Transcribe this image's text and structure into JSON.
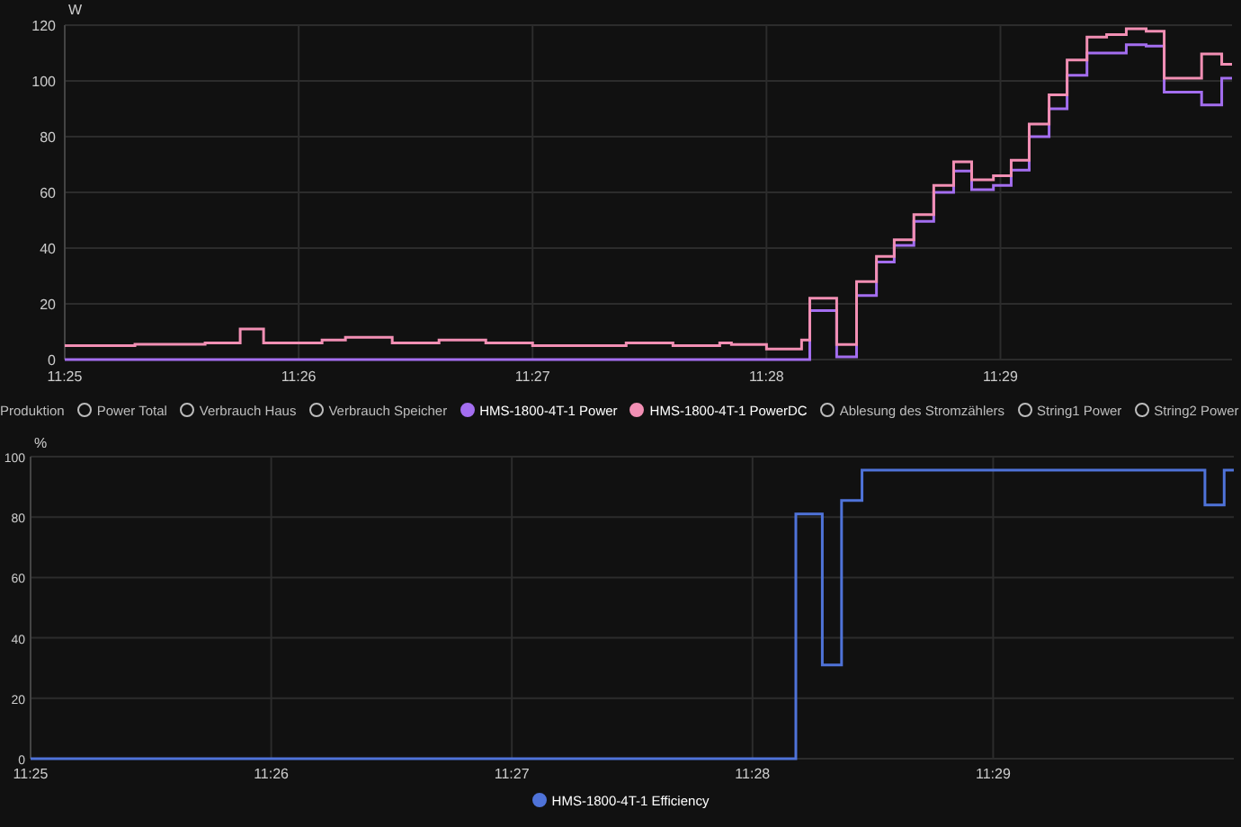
{
  "power_chart": {
    "chart_data": {
      "type": "line",
      "ylabel": "W",
      "x": [
        685,
        685.3,
        685.3,
        685.6,
        685.6,
        685.75,
        685.75,
        685.85,
        685.85,
        686.1,
        686.1,
        686.2,
        686.2,
        686.4,
        686.4,
        686.6,
        686.6,
        686.8,
        686.8,
        687.0,
        687.0,
        687.4,
        687.4,
        687.6,
        687.6,
        687.8,
        687.8,
        687.85,
        687.85,
        688.0,
        688.0,
        688.15,
        688.15,
        688.185,
        688.185,
        688.3,
        688.3,
        688.385,
        688.385,
        688.47,
        688.47,
        688.546,
        688.546,
        688.63,
        688.63,
        688.715,
        688.715,
        688.8,
        688.8,
        688.877,
        688.877,
        688.97,
        688.97,
        689.046,
        689.046,
        689.123,
        689.123,
        689.208,
        689.208,
        689.285,
        689.285,
        689.37,
        689.37,
        689.454,
        689.454,
        689.538,
        689.538,
        689.623,
        689.623,
        689.7,
        689.7,
        689.86,
        689.86,
        689.946,
        689.946,
        689.99
      ],
      "series": [
        {
          "color": "#a46ef0",
          "values": [
            0,
            0,
            0,
            0,
            0,
            0,
            0,
            0,
            0,
            0,
            0,
            0,
            0,
            0,
            0,
            0,
            0,
            0,
            0,
            0,
            0,
            0,
            0,
            0,
            0,
            0,
            0,
            0,
            0,
            0,
            0,
            0,
            0,
            0,
            17.6,
            17.6,
            1,
            1,
            23,
            23,
            35,
            35,
            41,
            41,
            49.6,
            49.6,
            60,
            60,
            67.7,
            67.7,
            61,
            61,
            62.5,
            62.5,
            68,
            68,
            80,
            80,
            90,
            90,
            102,
            102,
            110,
            110,
            110,
            110,
            113,
            113,
            112.5,
            112.5,
            96,
            96,
            91.4,
            91.4,
            101,
            101
          ]
        },
        {
          "color": "#f28fb4",
          "values": [
            5,
            5,
            5.5,
            5.5,
            6,
            6,
            11,
            11,
            6,
            6,
            7,
            7,
            8,
            8,
            6,
            6,
            7,
            7,
            6,
            6,
            5,
            5,
            6,
            6,
            5,
            5,
            6,
            6,
            5.4,
            5.4,
            3.8,
            3.8,
            7,
            7,
            22,
            22,
            5.4,
            5.4,
            28,
            28,
            37,
            37,
            43,
            43,
            52,
            52,
            62.5,
            62.5,
            71,
            71,
            64.5,
            64.5,
            66,
            66,
            71.5,
            71.5,
            84.5,
            84.5,
            95,
            95,
            107.5,
            107.5,
            115.7,
            115.7,
            116.6,
            116.6,
            118.7,
            118.7,
            117.8,
            117.8,
            101,
            101,
            109.7,
            109.7,
            106,
            106
          ]
        }
      ],
      "grid": true,
      "xlim": [
        685,
        689.99
      ],
      "ylim": [
        0,
        120
      ],
      "yticks": [
        0,
        20,
        40,
        60,
        80,
        100,
        120
      ],
      "xticks": [
        {
          "value": 685,
          "label": "11:25"
        },
        {
          "value": 686,
          "label": "11:26"
        },
        {
          "value": 687,
          "label": "11:27"
        },
        {
          "value": 688,
          "label": "11:28"
        },
        {
          "value": 689,
          "label": "11:29"
        }
      ]
    }
  },
  "legend": [
    {
      "label": "Produktion",
      "kind": "cut",
      "selected": false
    },
    {
      "label": "Power Total",
      "kind": "item",
      "selected": false
    },
    {
      "label": "Verbrauch Haus",
      "kind": "item",
      "selected": false
    },
    {
      "label": "Verbrauch Speicher",
      "kind": "item",
      "selected": false
    },
    {
      "label": "HMS-1800-4T-1 Power",
      "kind": "item",
      "selected": true,
      "color": "#a46ef0"
    },
    {
      "label": "HMS-1800-4T-1 PowerDC",
      "kind": "item",
      "selected": true,
      "color": "#f28fb4"
    },
    {
      "label": "Ablesung des Stromzählers",
      "kind": "item",
      "selected": false
    },
    {
      "label": "String1 Power",
      "kind": "item",
      "selected": false
    },
    {
      "label": "String2 Power",
      "kind": "item",
      "selected": false
    }
  ],
  "efficiency_chart": {
    "chart_data": {
      "type": "line",
      "ylabel": "%",
      "x": [
        685,
        688.18,
        688.18,
        688.29,
        688.29,
        688.37,
        688.37,
        688.455,
        688.455,
        689.88,
        689.88,
        689.96,
        689.96,
        690
      ],
      "series": [
        {
          "color": "#4f73d9",
          "values": [
            0,
            0,
            81,
            81,
            31,
            31,
            85.5,
            85.5,
            95.5,
            95.5,
            84,
            84,
            95.5,
            95.5
          ]
        }
      ],
      "grid": true,
      "xlim": [
        685,
        690
      ],
      "ylim": [
        0,
        100
      ],
      "yticks": [
        0,
        20,
        40,
        60,
        80,
        100
      ],
      "xticks": [
        {
          "value": 685,
          "label": "11:25"
        },
        {
          "value": 686,
          "label": "11:26"
        },
        {
          "value": 687,
          "label": "11:27"
        },
        {
          "value": 688,
          "label": "11:28"
        },
        {
          "value": 689,
          "label": "11:29"
        }
      ]
    }
  },
  "efficiency_legend": [
    {
      "label": "HMS-1800-4T-1 Efficiency",
      "kind": "item",
      "selected": true,
      "color": "#4f73d9"
    }
  ]
}
